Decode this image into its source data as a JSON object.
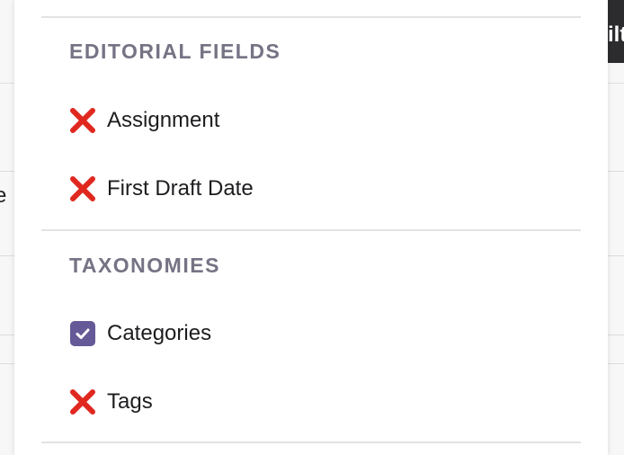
{
  "background": {
    "left_fragment_text": "e",
    "right_button_text": "ilt"
  },
  "colors": {
    "x_mark": "#e0281f",
    "checkbox_fill": "#655997",
    "section_title": "#757384"
  },
  "sections": [
    {
      "title": "EDITORIAL FIELDS",
      "items": [
        {
          "label": "Assignment",
          "state": "unchecked",
          "icon": "red-cross-icon"
        },
        {
          "label": "First Draft Date",
          "state": "unchecked",
          "icon": "red-cross-icon"
        }
      ]
    },
    {
      "title": "TAXONOMIES",
      "items": [
        {
          "label": "Categories",
          "state": "checked",
          "icon": "checkbox-checked-icon"
        },
        {
          "label": "Tags",
          "state": "unchecked",
          "icon": "red-cross-icon"
        }
      ]
    }
  ]
}
